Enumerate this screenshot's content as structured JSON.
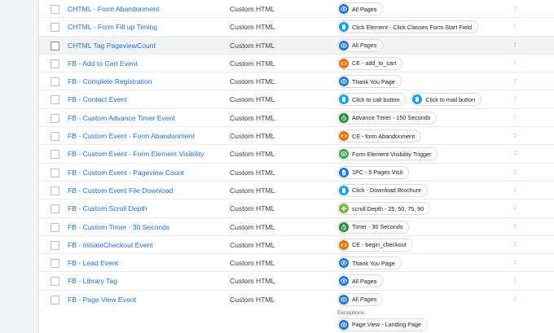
{
  "tags": [
    {
      "name": "CHTML - Form Abandonment",
      "type": "Custom HTML",
      "triggers": [
        {
          "label": "All Pages",
          "icon": "eye",
          "color": "#1a73e8"
        }
      ]
    },
    {
      "name": "CHTML - Form Fill up Timing",
      "type": "Custom HTML",
      "triggers": [
        {
          "label": "Click Element - Click Classes Form Start Field",
          "icon": "click",
          "color": "#12a4e0"
        }
      ]
    },
    {
      "name": "CHTML Tag PageviewCount",
      "type": "Custom HTML",
      "highlighted": true,
      "triggers": [
        {
          "label": "All Pages",
          "icon": "eye",
          "color": "#1a73e8"
        }
      ]
    },
    {
      "name": "FB - Add to Cart Event",
      "type": "Custom HTML",
      "triggers": [
        {
          "label": "CE - add_to_cart",
          "icon": "code",
          "color": "#e8710a"
        }
      ]
    },
    {
      "name": "FB - Complete Registration",
      "type": "Custom HTML",
      "triggers": [
        {
          "label": "Thank You Page",
          "icon": "eye",
          "color": "#1a73e8"
        }
      ]
    },
    {
      "name": "FB - Contact Event",
      "type": "Custom HTML",
      "triggers": [
        {
          "label": "Click to call button",
          "icon": "click",
          "color": "#12a4e0"
        },
        {
          "label": "Click to mail button",
          "icon": "click",
          "color": "#12a4e0"
        }
      ]
    },
    {
      "name": "FB - Custom Advance Timer Event",
      "type": "Custom HTML",
      "triggers": [
        {
          "label": "Advance Timer - 150 Seconds",
          "icon": "timer",
          "color": "#1e8e3e"
        }
      ]
    },
    {
      "name": "FB - Custom Event - Form Abandonment",
      "type": "Custom HTML",
      "triggers": [
        {
          "label": "CE - form Abandonment",
          "icon": "code",
          "color": "#e8710a"
        }
      ]
    },
    {
      "name": "FB - Custom Event - Form Element Visibility",
      "type": "Custom HTML",
      "triggers": [
        {
          "label": "Form Element Visibility Trigger",
          "icon": "eye",
          "color": "#34a853"
        }
      ]
    },
    {
      "name": "FB - Custom Event - Pageview Count",
      "type": "Custom HTML",
      "triggers": [
        {
          "label": "1PC - 5 Pages Visit",
          "icon": "doc",
          "color": "#1a73e8"
        }
      ]
    },
    {
      "name": "FB - Custom Event File Download",
      "type": "Custom HTML",
      "triggers": [
        {
          "label": "Click - Download Brochure",
          "icon": "click",
          "color": "#12a4e0"
        }
      ]
    },
    {
      "name": "FB - Custom Scroll Depth",
      "type": "Custom HTML",
      "triggers": [
        {
          "label": "scroll Depth - 25, 50, 75, 90",
          "icon": "scroll",
          "color": "#7cb342"
        }
      ]
    },
    {
      "name": "FB - Custom Timer - 30 Seconds",
      "type": "Custom HTML",
      "triggers": [
        {
          "label": "Timer - 30 Seconds",
          "icon": "timer",
          "color": "#1e8e3e"
        }
      ]
    },
    {
      "name": "FB - InitiateCheckout Event",
      "type": "Custom HTML",
      "triggers": [
        {
          "label": "CE - begin_checkout",
          "icon": "code",
          "color": "#e8710a"
        }
      ]
    },
    {
      "name": "FB - Lead Event",
      "type": "Custom HTML",
      "triggers": [
        {
          "label": "Thank You Page",
          "icon": "eye",
          "color": "#1a73e8"
        }
      ]
    },
    {
      "name": "FB - Library Tag",
      "type": "Custom HTML",
      "triggers": [
        {
          "label": "All Pages",
          "icon": "eye",
          "color": "#1a73e8"
        }
      ]
    },
    {
      "name": "FB - Page View Event",
      "type": "Custom HTML",
      "triggers": [
        {
          "label": "All Pages",
          "icon": "eye",
          "color": "#1a73e8"
        }
      ],
      "exceptions_label": "Exceptions:",
      "exceptions": [
        {
          "label": "Page View - Landing Page",
          "icon": "eye",
          "color": "#1a73e8"
        }
      ]
    }
  ]
}
